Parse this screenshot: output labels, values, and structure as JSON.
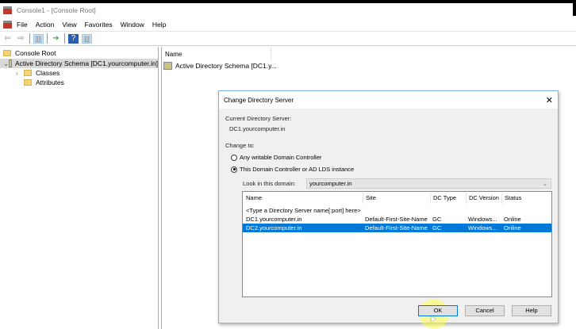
{
  "window": {
    "title": "Console1 - [Console Root]"
  },
  "menu": [
    "File",
    "Action",
    "View",
    "Favorites",
    "Window",
    "Help"
  ],
  "tree": {
    "root": "Console Root",
    "schema": "Active Directory Schema [DC1.yourcomputer.in]",
    "children": [
      "Classes",
      "Attributes"
    ]
  },
  "right_pane": {
    "column": "Name",
    "item": "Active Directory Schema [DC1.y..."
  },
  "dialog": {
    "title": "Change Directory Server",
    "current_label": "Current Directory Server:",
    "current_value": "DC1.yourcomputer.in",
    "change_to": "Change to:",
    "radio_any": "Any writable Domain Controller",
    "radio_this": "This Domain Controller or AD LDS instance",
    "look_label": "Look in this domain:",
    "look_value": "yourcomputer.in",
    "columns": [
      "Name",
      "Site",
      "DC Type",
      "DC Version",
      "Status"
    ],
    "placeholder_row": "<Type a Directory Server name[:port] here>",
    "rows": [
      {
        "name": "DC1.yourcomputer.in",
        "site": "Default-First-Site-Name",
        "type": "GC",
        "version": "Windows...",
        "status": "Online"
      },
      {
        "name": "DC2.yourcomputer.in",
        "site": "Default-First-Site-Name",
        "type": "GC",
        "version": "Windows...",
        "status": "Online"
      }
    ],
    "ok": "OK",
    "cancel": "Cancel",
    "help": "Help"
  }
}
